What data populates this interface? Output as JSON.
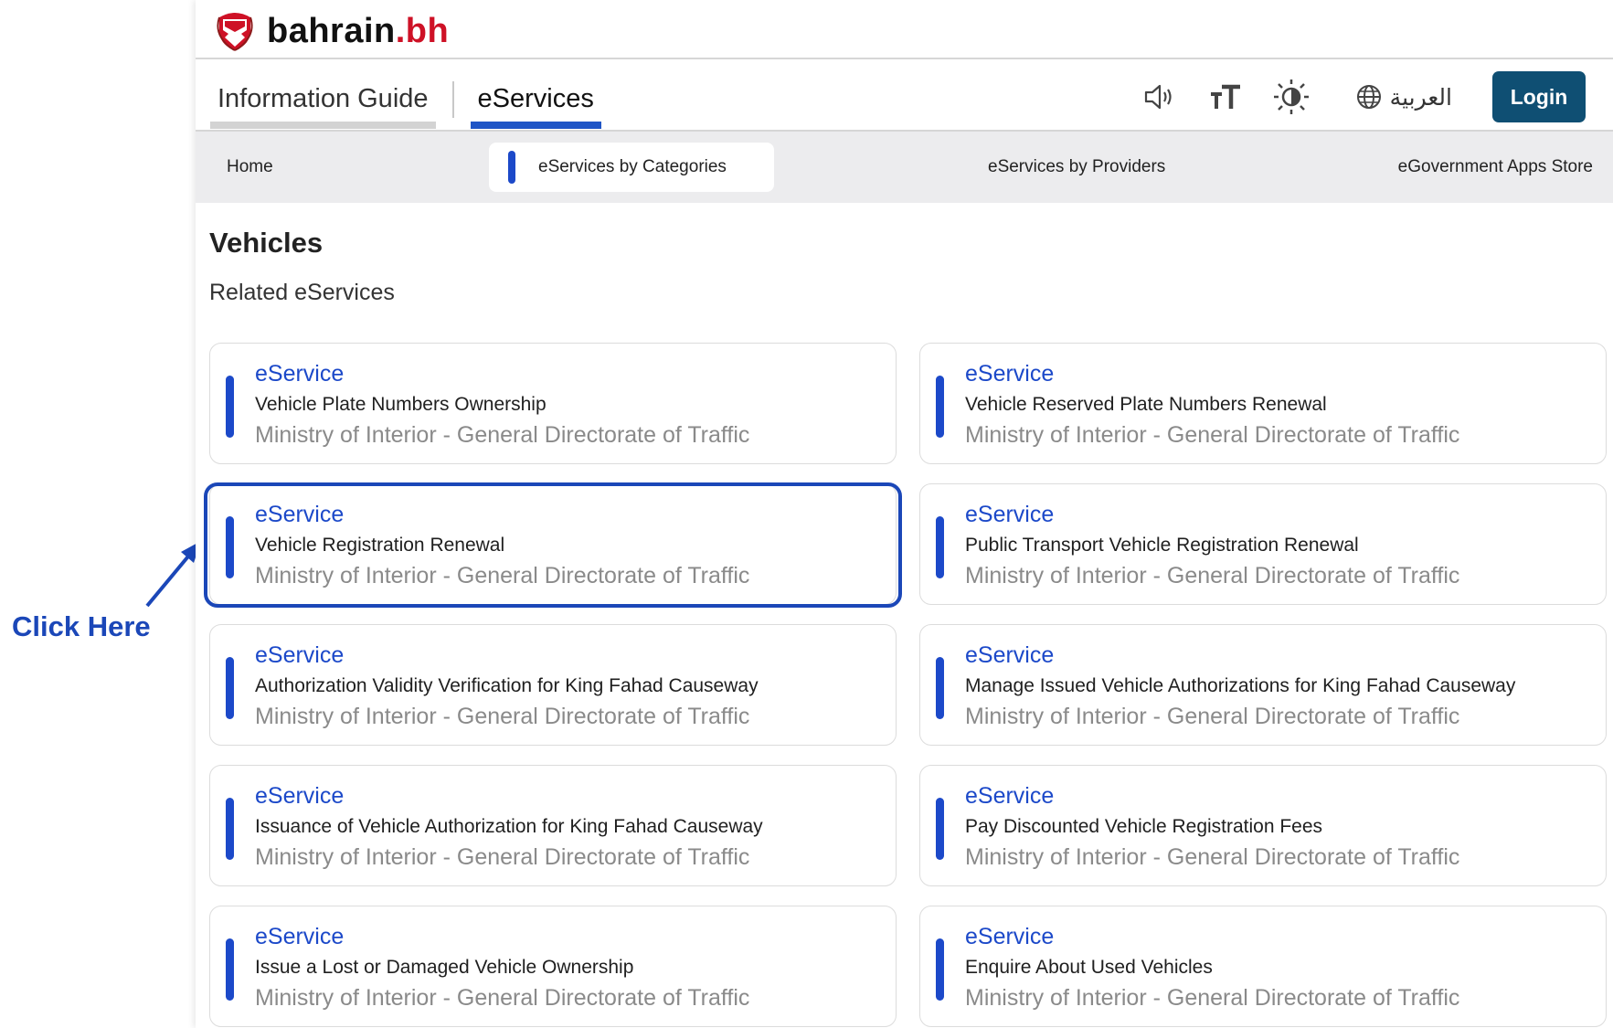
{
  "header": {
    "brand_main": "bahrain",
    "brand_suffix": ".bh",
    "logo_icon": "bahrain-emblem-icon"
  },
  "tabs": [
    {
      "label": "Information Guide",
      "active": false
    },
    {
      "label": "eServices",
      "active": true
    }
  ],
  "tools": {
    "icons": [
      "speaker-icon",
      "text-size-icon",
      "contrast-icon",
      "globe-icon"
    ],
    "language_label": "العربية",
    "login_label": "Login"
  },
  "subnav": {
    "items": [
      "Home",
      "eServices by Categories",
      "eServices by Providers",
      "eGovernment Apps Store"
    ],
    "selected": "eServices by Categories"
  },
  "page": {
    "title": "Vehicles",
    "subtitle": "Related eServices"
  },
  "cards": [
    {
      "type": "eService",
      "name": "Vehicle Plate Numbers Ownership",
      "provider": "Ministry of Interior - General Directorate of Traffic"
    },
    {
      "type": "eService",
      "name": "Vehicle Reserved Plate Numbers Renewal",
      "provider": "Ministry of Interior - General Directorate of Traffic"
    },
    {
      "type": "eService",
      "name": "Vehicle Registration Renewal",
      "provider": "Ministry of Interior - General Directorate of Traffic"
    },
    {
      "type": "eService",
      "name": "Public Transport Vehicle Registration Renewal",
      "provider": "Ministry of Interior - General Directorate of Traffic"
    },
    {
      "type": "eService",
      "name": "Authorization Validity Verification for King Fahad Causeway",
      "provider": "Ministry of Interior - General Directorate of Traffic"
    },
    {
      "type": "eService",
      "name": "Manage Issued Vehicle Authorizations for King Fahad Causeway",
      "provider": "Ministry of Interior - General Directorate of Traffic"
    },
    {
      "type": "eService",
      "name": "Issuance of Vehicle Authorization for King Fahad Causeway",
      "provider": "Ministry of Interior - General Directorate of Traffic"
    },
    {
      "type": "eService",
      "name": "Pay Discounted Vehicle Registration Fees",
      "provider": "Ministry of Interior - General Directorate of Traffic"
    },
    {
      "type": "eService",
      "name": "Issue a Lost or Damaged Vehicle Ownership",
      "provider": "Ministry of Interior - General Directorate of Traffic"
    },
    {
      "type": "eService",
      "name": "Enquire About Used Vehicles",
      "provider": "Ministry of Interior - General Directorate of Traffic"
    }
  ],
  "annotation": {
    "label": "Click Here",
    "highlighted_card": "Vehicle Registration Renewal",
    "color": "#1b47b8"
  },
  "colors": {
    "accent": "#1c49c9",
    "login_bg": "#0f4f73",
    "brand_red": "#ce1126",
    "subnav_bg": "#ececee"
  }
}
